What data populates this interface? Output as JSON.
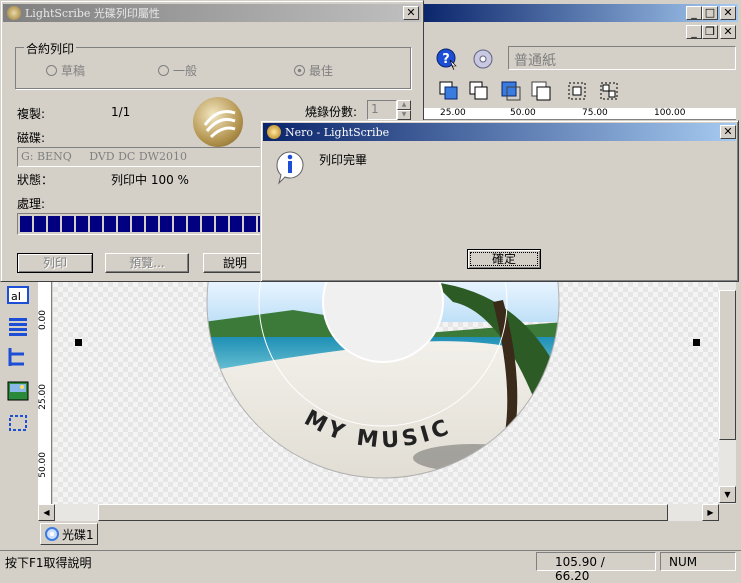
{
  "main_window": {
    "toolbar_paper_type": "普通紙",
    "ruler_labels": [
      "25.00",
      "50.00",
      "75.00",
      "100.00"
    ],
    "vruler_labels": [
      "0.00",
      "25.00",
      "50.00"
    ],
    "canvas_text": "MY MUSIC",
    "tab_label": "光碟1",
    "status_hint": "按下F1取得說明",
    "status_coords": "105.90 / 66.20",
    "status_num": "NUM"
  },
  "print_dialog": {
    "title": "LightScribe 光碟列印屬性",
    "contract_group": "合約列印",
    "quality_options": [
      "草稿",
      "一般",
      "最佳"
    ],
    "copies_label": "複製:",
    "copies_value": "1/1",
    "burn_copies_label": "燒錄份數:",
    "burn_copies_value": "1",
    "drive_label": "磁碟:",
    "drive_value": "G: BENQ     DVD DC DW2010",
    "status_label": "狀態：",
    "status_value": "列印中 100 %",
    "process_label": "處理:",
    "progress": 1.0,
    "buttons": {
      "print": "列印",
      "preview": "預覽...",
      "help": "說明"
    }
  },
  "message_box": {
    "title": "Nero - LightScribe",
    "message": "列印完畢",
    "ok": "確定"
  },
  "colors": {
    "titlebar_active": "#0a246a",
    "titlebar_gradient": "#a6caf0",
    "titlebar_inactive": "#808080",
    "progress": "#000080"
  }
}
